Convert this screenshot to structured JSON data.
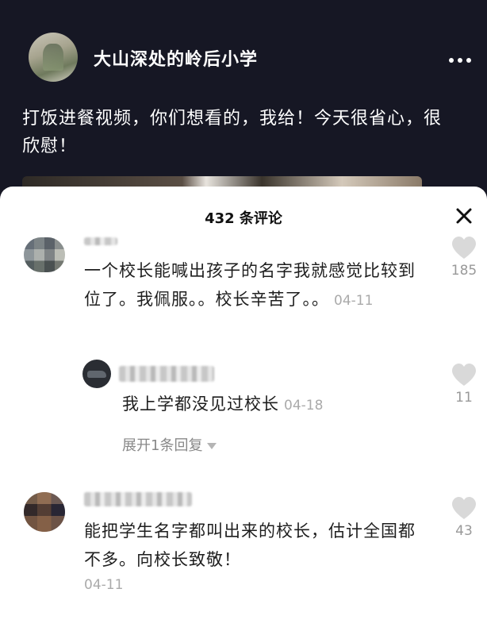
{
  "post": {
    "author": "大山深处的岭后小学",
    "caption": "打饭进餐视频，你们想看的，我给！今天很省心，很欣慰！"
  },
  "sheet": {
    "title": "432 条评论"
  },
  "comments": [
    {
      "text": "一个校长能喊出孩子的名字我就感觉比较到位了。我佩服。。校长辛苦了。。",
      "date": "04-11",
      "likes": "185"
    },
    {
      "text": "能把学生名字都叫出来的校长，估计全国都不多。向校长致敬！",
      "date": "04-11",
      "likes": "43"
    }
  ],
  "reply": {
    "text": "我上学都没见过校长",
    "date": "04-18",
    "likes": "11",
    "expand_label": "展开1条回复"
  },
  "colors": {
    "post_background": "#161724",
    "sheet_background": "#ffffff",
    "meta_gray": "#aaaaaa"
  },
  "icons": [
    "more-icon",
    "close-icon",
    "heart-icon",
    "caret-down-icon"
  ]
}
